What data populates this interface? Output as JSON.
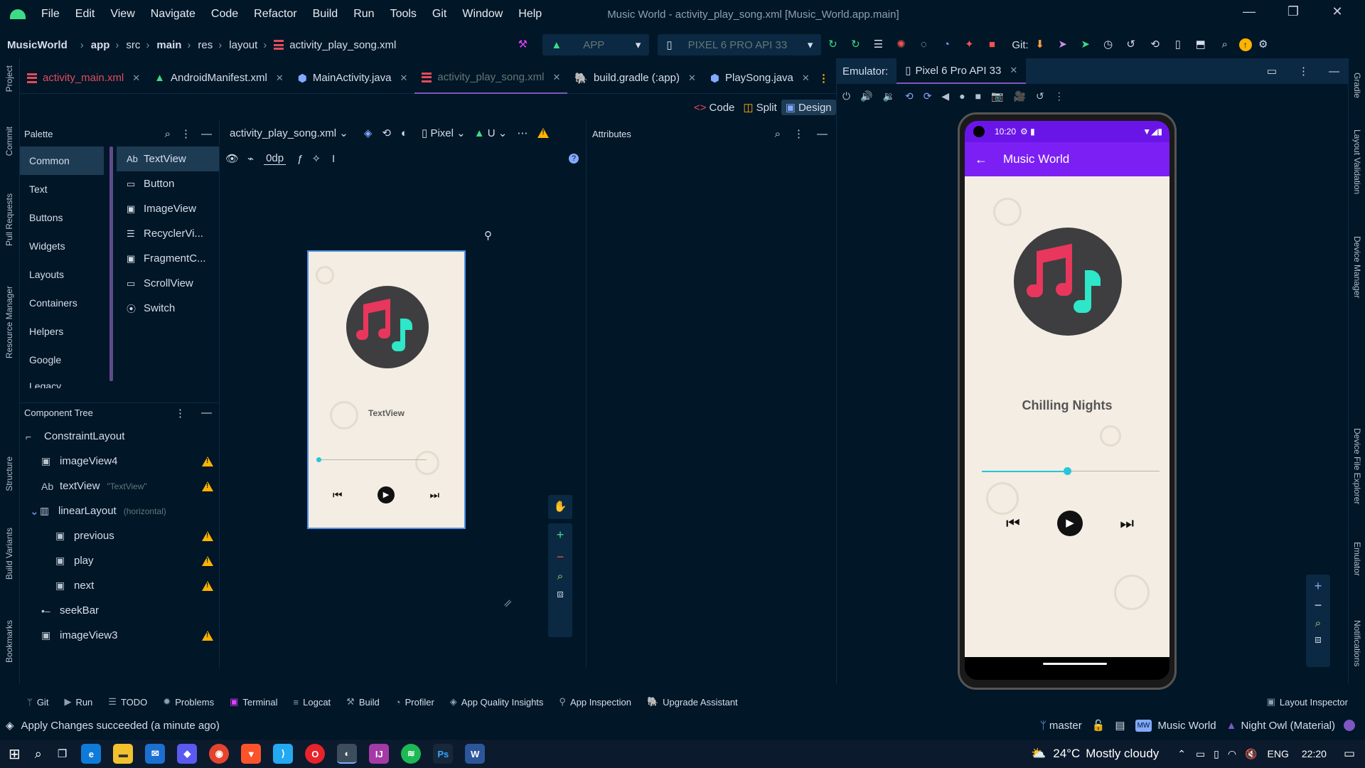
{
  "window": {
    "title": "Music World - activity_play_song.xml [Music_World.app.main]",
    "menu": [
      "File",
      "Edit",
      "View",
      "Navigate",
      "Code",
      "Refactor",
      "Build",
      "Run",
      "Tools",
      "Git",
      "Window",
      "Help"
    ],
    "controls": [
      "—",
      "❐",
      "✕"
    ]
  },
  "breadcrumb": {
    "project": "MusicWorld",
    "items": [
      "app",
      "src",
      "main",
      "res",
      "layout",
      "activity_play_song.xml"
    ]
  },
  "toolbar": {
    "config": "APP",
    "device": "PIXEL 6 PRO API 33",
    "git_label": "Git:"
  },
  "side_left": [
    "Project",
    "Commit",
    "Pull Requests",
    "Resource Manager",
    "Structure",
    "Build Variants",
    "Bookmarks"
  ],
  "side_right": [
    "Gradle",
    "Layout Validation",
    "Device Manager",
    "Device File Explorer",
    "Emulator",
    "Notifications"
  ],
  "tabs": [
    {
      "label": "activity_main.xml",
      "icon": "xml-layout-icon",
      "active": false
    },
    {
      "label": "AndroidManifest.xml",
      "icon": "android-icon",
      "active": false
    },
    {
      "label": "MainActivity.java",
      "icon": "java-class-icon",
      "active": false
    },
    {
      "label": "activity_play_song.xml",
      "icon": "xml-layout-icon",
      "active": true
    },
    {
      "label": "build.gradle (:app)",
      "icon": "gradle-icon",
      "active": false
    },
    {
      "label": "PlaySong.java",
      "icon": "java-class-icon",
      "active": false
    }
  ],
  "view_modes": {
    "code": "Code",
    "split": "Split",
    "design": "Design"
  },
  "palette": {
    "title": "Palette",
    "categories": [
      "Common",
      "Text",
      "Buttons",
      "Widgets",
      "Layouts",
      "Containers",
      "Helpers",
      "Google",
      "Legacy"
    ],
    "selected": "Common",
    "items": [
      {
        "icon": "Ab",
        "label": "TextView"
      },
      {
        "icon": "▭",
        "label": "Button"
      },
      {
        "icon": "▣",
        "label": "ImageView"
      },
      {
        "icon": "☰",
        "label": "RecyclerVi..."
      },
      {
        "icon": "▣",
        "label": "FragmentC..."
      },
      {
        "icon": "▭",
        "label": "ScrollView"
      },
      {
        "icon": "⦿",
        "label": "Switch"
      }
    ]
  },
  "design_bar": {
    "file": "activity_play_song.xml",
    "device": "Pixel",
    "api": "U",
    "margin": "0dp"
  },
  "attributes": {
    "title": "Attributes"
  },
  "tree": {
    "title": "Component Tree",
    "nodes": [
      {
        "label": "ConstraintLayout",
        "hint": "",
        "icon": "constraint-icon",
        "level": 0,
        "warn": false
      },
      {
        "label": "imageView4",
        "hint": "",
        "icon": "image-icon",
        "level": 1,
        "warn": true
      },
      {
        "label": "textView",
        "hint": "\"TextView\"",
        "icon": "textview-icon",
        "level": 1,
        "warn": true
      },
      {
        "label": "linearLayout",
        "hint": "(horizontal)",
        "icon": "linear-icon",
        "level": 1,
        "warn": false
      },
      {
        "label": "previous",
        "hint": "",
        "icon": "image-icon",
        "level": 2,
        "warn": true
      },
      {
        "label": "play",
        "hint": "",
        "icon": "image-icon",
        "level": 2,
        "warn": true
      },
      {
        "label": "next",
        "hint": "",
        "icon": "image-icon",
        "level": 2,
        "warn": true
      },
      {
        "label": "seekBar",
        "hint": "",
        "icon": "seekbar-icon",
        "level": 1,
        "warn": false
      },
      {
        "label": "imageView3",
        "hint": "",
        "icon": "image-icon",
        "level": 1,
        "warn": true
      }
    ]
  },
  "preview": {
    "text": "TextView",
    "seek_progress": 0.0
  },
  "emulator": {
    "label": "Emulator:",
    "tab": "Pixel 6 Pro API 33",
    "time": "10:20",
    "app_title": "Music World",
    "song": "Chilling Nights",
    "seek_progress": 0.48
  },
  "bottom_tools": [
    {
      "icon": "git-icon",
      "label": "Git"
    },
    {
      "icon": "run-icon",
      "label": "Run"
    },
    {
      "icon": "todo-icon",
      "label": "TODO"
    },
    {
      "icon": "problems-icon",
      "label": "Problems"
    },
    {
      "icon": "terminal-icon",
      "label": "Terminal"
    },
    {
      "icon": "logcat-icon",
      "label": "Logcat"
    },
    {
      "icon": "build-icon",
      "label": "Build"
    },
    {
      "icon": "profiler-icon",
      "label": "Profiler"
    },
    {
      "icon": "quality-icon",
      "label": "App Quality Insights"
    },
    {
      "icon": "inspection-icon",
      "label": "App Inspection"
    },
    {
      "icon": "upgrade-icon",
      "label": "Upgrade Assistant"
    }
  ],
  "layout_inspector": "Layout Inspector",
  "status": {
    "message": "Apply Changes succeeded (a minute ago)",
    "branch": "master",
    "project_badge": "MW",
    "project": "Music World",
    "theme": "Night Owl (Material)"
  },
  "taskbar": {
    "weather_temp": "24°C",
    "weather_text": "Mostly cloudy",
    "lang": "ENG",
    "clock": "22:20"
  },
  "colors": {
    "bg": "#011627",
    "accent": "#7e57c2",
    "app_bar": "#7c1ff5",
    "seek": "#26c6da"
  }
}
